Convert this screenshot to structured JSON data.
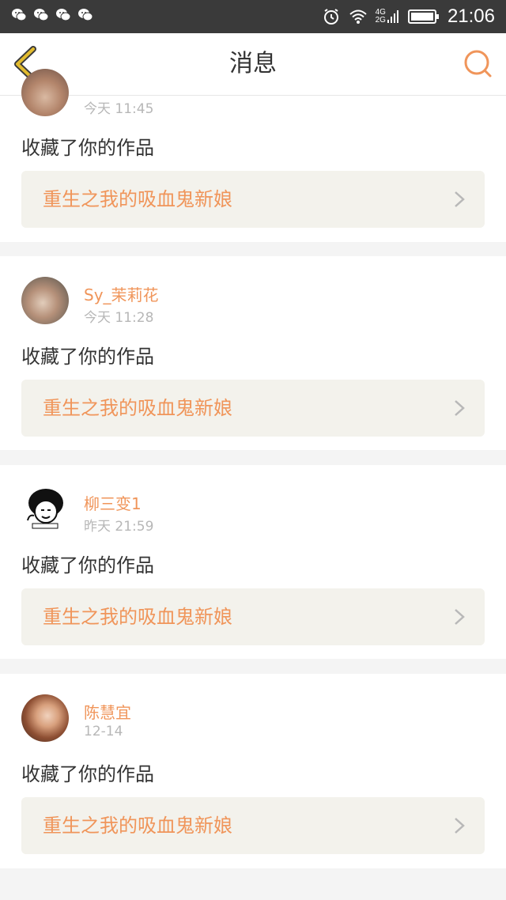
{
  "status_bar": {
    "time": "21:06",
    "notification_icons": [
      "wechat-icon",
      "wechat-icon",
      "wechat-icon",
      "wechat-icon"
    ],
    "right_icons": [
      "alarm-icon",
      "wifi-icon",
      "signal-4g-2g-icon",
      "battery-icon"
    ],
    "network_top": "4G",
    "network_bottom": "2G"
  },
  "nav": {
    "title": "消息",
    "back_icon": "chevron-left-icon",
    "search_icon": "search-icon",
    "accent": "#f0955a",
    "back_color": "#e2bb2e"
  },
  "messages": [
    {
      "username": "",
      "time": "今天 11:45",
      "action": "收藏了你的作品",
      "work_title": "重生之我的吸血鬼新娘"
    },
    {
      "username": "Sy_茉莉花",
      "time": "今天 11:28",
      "action": "收藏了你的作品",
      "work_title": "重生之我的吸血鬼新娘"
    },
    {
      "username": "柳三变1",
      "time": "昨天 21:59",
      "action": "收藏了你的作品",
      "work_title": "重生之我的吸血鬼新娘"
    },
    {
      "username": "陈慧宜",
      "time": "12-14",
      "action": "收藏了你的作品",
      "work_title": "重生之我的吸血鬼新娘"
    }
  ]
}
